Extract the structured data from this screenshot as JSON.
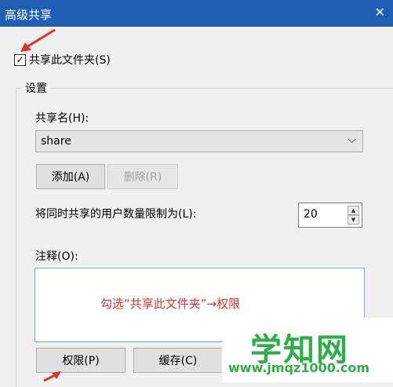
{
  "window": {
    "title": "高级共享"
  },
  "share_checkbox": {
    "label": "共享此文件夹(S)",
    "checked": true,
    "check_mark": "✓"
  },
  "settings": {
    "legend": "设置",
    "share_name_label": "共享名(H):",
    "share_name_value": "share",
    "add_button": "添加(A)",
    "remove_button": "删除(R)",
    "user_limit_label": "将同时共享的用户数量限制为(L):",
    "user_limit_value": "20",
    "comment_label": "注释(O):"
  },
  "buttons": {
    "permissions": "权限(P)",
    "caching": "缓存(C)"
  },
  "annotation_text": "勾选“共享此文件夹”→权限",
  "watermark": {
    "title": "学知网",
    "url": "www.jmqz1000.com"
  },
  "colors": {
    "titlebar": "#1e5fb3",
    "annotation": "#e03030",
    "watermark": "#2eae46"
  }
}
